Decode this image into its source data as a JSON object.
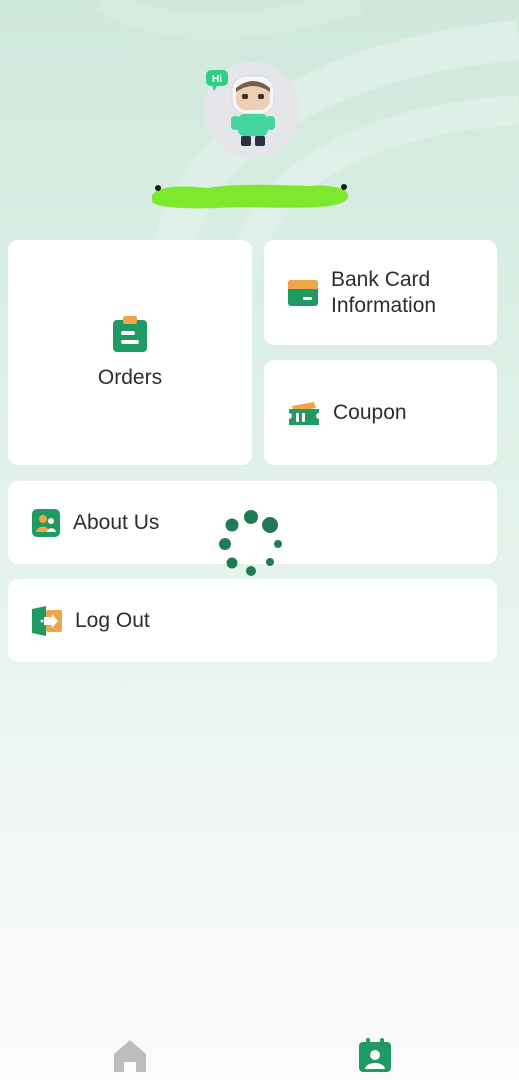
{
  "avatar": {
    "badge_text": "Hi"
  },
  "menu": {
    "orders": {
      "label": "Orders",
      "icon": "clipboard-icon"
    },
    "bank_card": {
      "label_line1": "Bank Card",
      "label_line2": "Information",
      "icon": "card-icon"
    },
    "coupon": {
      "label": "Coupon",
      "icon": "ticket-icon"
    },
    "about": {
      "label": "About Us",
      "icon": "people-icon"
    },
    "logout": {
      "label": "Log Out",
      "icon": "exit-door-icon"
    }
  },
  "tabbar": {
    "items": [
      {
        "name": "home",
        "icon": "home-icon",
        "active": false
      },
      {
        "name": "profile",
        "icon": "profile-icon",
        "active": true
      }
    ]
  },
  "colors": {
    "accent": "#1e9a62",
    "accent_dark": "#177a4d",
    "icon_orange": "#f0a646",
    "inactive_tab": "#bdbdbd",
    "redaction": "#7ee82c"
  }
}
